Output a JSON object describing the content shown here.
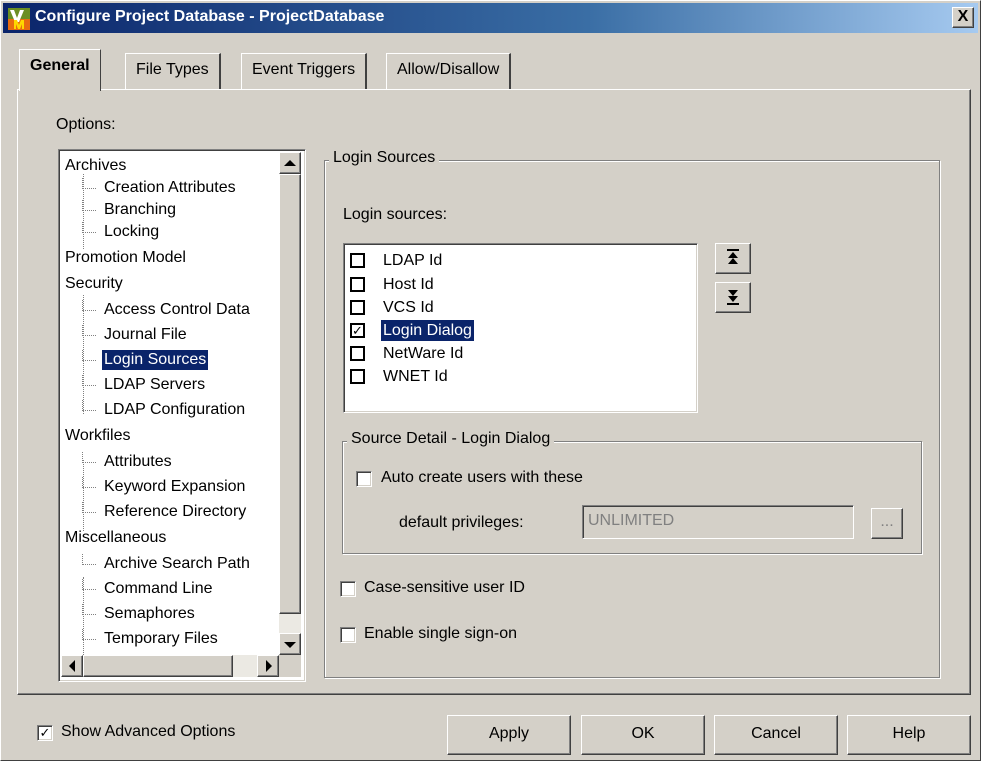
{
  "window": {
    "title": "Configure Project Database - ProjectDatabase",
    "close_glyph": "X",
    "app_icon": "vm-app-icon"
  },
  "tabs": [
    {
      "label": "General",
      "active": true
    },
    {
      "label": "File Types",
      "active": false
    },
    {
      "label": "Event Triggers",
      "active": false
    },
    {
      "label": "Allow/Disallow",
      "active": false
    }
  ],
  "options": {
    "label": "Options:",
    "tree": [
      {
        "label": "Archives",
        "level": 0
      },
      {
        "label": "Creation Attributes",
        "level": 1
      },
      {
        "label": "Branching",
        "level": 1
      },
      {
        "label": "Locking",
        "level": 1
      },
      {
        "label": "Promotion Model",
        "level": 0
      },
      {
        "label": "Security",
        "level": 0
      },
      {
        "label": "Access Control Data",
        "level": 1
      },
      {
        "label": "Journal File",
        "level": 1
      },
      {
        "label": "Login Sources",
        "level": 1,
        "selected": true
      },
      {
        "label": "LDAP Servers",
        "level": 1
      },
      {
        "label": "LDAP Configuration",
        "level": 1
      },
      {
        "label": "Workfiles",
        "level": 0
      },
      {
        "label": "Attributes",
        "level": 1
      },
      {
        "label": "Keyword Expansion",
        "level": 1
      },
      {
        "label": "Reference Directory",
        "level": 1
      },
      {
        "label": "Miscellaneous",
        "level": 0
      },
      {
        "label": "Archive Search Path",
        "level": 1
      },
      {
        "label": "Command Line",
        "level": 1
      },
      {
        "label": "Semaphores",
        "level": 1
      },
      {
        "label": "Temporary Files",
        "level": 1
      }
    ]
  },
  "login_sources": {
    "group_title": "Login Sources",
    "list_label": "Login sources:",
    "items": [
      {
        "label": "LDAP Id",
        "checked": false,
        "mark": ""
      },
      {
        "label": "Host Id",
        "checked": false,
        "mark": ""
      },
      {
        "label": "VCS Id",
        "checked": false,
        "mark": ""
      },
      {
        "label": "Login Dialog",
        "checked": true,
        "mark": "✓",
        "selected": true
      },
      {
        "label": "NetWare Id",
        "checked": false,
        "mark": ""
      },
      {
        "label": "WNET Id",
        "checked": false,
        "mark": ""
      }
    ],
    "move_up_icon": "move-up-icon",
    "move_down_icon": "move-down-icon",
    "detail": {
      "group_title": "Source Detail - Login Dialog",
      "auto_create_label": "Auto create users with these",
      "auto_create_checked": false,
      "default_privileges_label": "default privileges:",
      "default_privileges_value": "UNLIMITED",
      "browse_label": "..."
    },
    "case_sensitive_label": "Case-sensitive user ID",
    "case_sensitive_checked": false,
    "single_sign_on_label": "Enable single sign-on",
    "single_sign_on_checked": false
  },
  "footer": {
    "show_advanced_label": "Show Advanced Options",
    "show_advanced_checked": true,
    "show_advanced_mark": "✓",
    "apply_label": "Apply",
    "ok_label": "OK",
    "cancel_label": "Cancel",
    "help_label": "Help"
  },
  "colors": {
    "face": "#d4d0c8",
    "title_bar_start": "#0a246a",
    "title_bar_end": "#a6caf0",
    "selection": "#0a246a"
  }
}
